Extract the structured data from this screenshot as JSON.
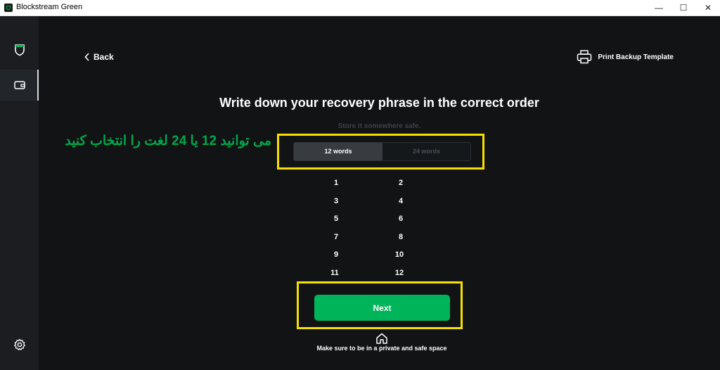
{
  "window": {
    "title": "Blockstream Green",
    "minimize_glyph": "—",
    "maximize_glyph": "☐",
    "close_glyph": "✕"
  },
  "sidebar": {
    "items": [
      {
        "icon": "shield-icon"
      },
      {
        "icon": "wallet-icon",
        "active": true
      }
    ],
    "bottom_icon": "gear-icon"
  },
  "header": {
    "back_label": "Back",
    "print_label": "Print Backup Template"
  },
  "main": {
    "title": "Write down your recovery phrase in the correct order",
    "subtitle": "Store it somewhere safe.",
    "word_count_options": [
      "12 words",
      "24 words"
    ],
    "selected_option": "12 words",
    "word_numbers_left": [
      "1",
      "3",
      "5",
      "7",
      "9",
      "11"
    ],
    "word_numbers_right": [
      "2",
      "4",
      "6",
      "8",
      "10",
      "12"
    ],
    "next_label": "Next",
    "footnote": "Make sure to be in a private and safe space"
  },
  "annotation": {
    "text": "می توانید 12 یا 24 لغت را انتخاب کنید",
    "highlight_color": "#f5e000",
    "text_color": "#00a84a"
  },
  "colors": {
    "accent": "#00b45a",
    "background": "#111315",
    "sidebar": "#1b1d21"
  }
}
